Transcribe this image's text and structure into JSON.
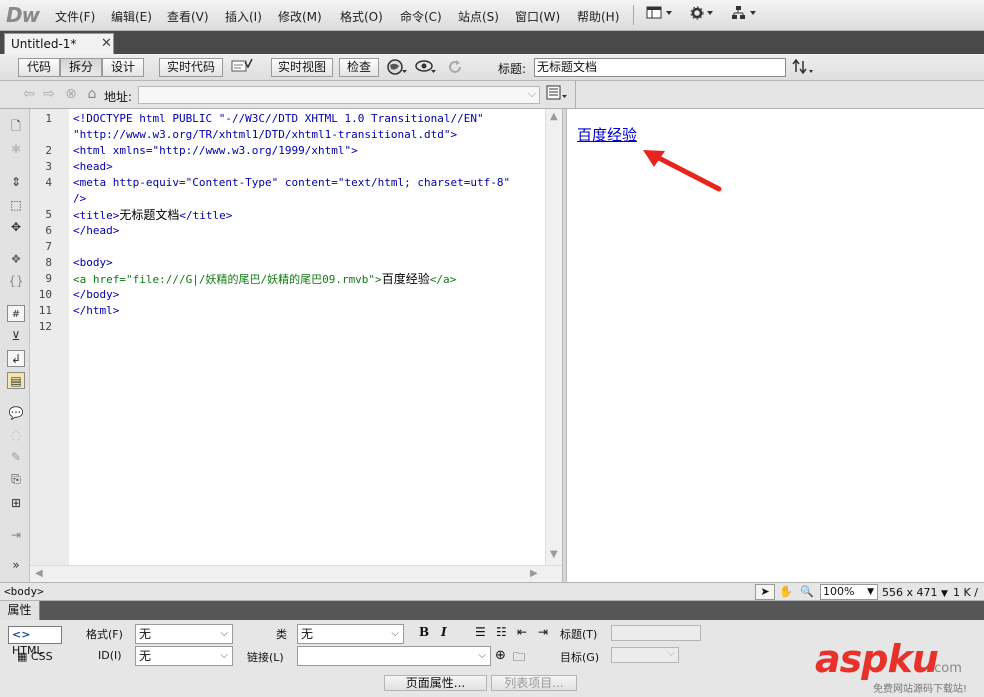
{
  "app": {
    "logo": "Dw"
  },
  "menu": {
    "items": [
      "文件(F)",
      "编辑(E)",
      "查看(V)",
      "插入(I)",
      "修改(M)",
      "格式(O)",
      "命令(C)",
      "站点(S)",
      "窗口(W)",
      "帮助(H)"
    ]
  },
  "tab": {
    "title": "Untitled-1*"
  },
  "doc_toolbar": {
    "code": "代码",
    "split": "拆分",
    "design": "设计",
    "live_code": "实时代码",
    "live_view": "实时视图",
    "inspect": "检查",
    "title_label": "标题:",
    "title_value": "无标题文档"
  },
  "address": {
    "label": "地址:",
    "value": ""
  },
  "code": {
    "lines": [
      {
        "num": "1",
        "text": "<!DOCTYPE html PUBLIC \"-//W3C//DTD XHTML 1.0 Transitional//EN\""
      },
      {
        "num": "",
        "text": "\"http://www.w3.org/TR/xhtml1/DTD/xhtml1-transitional.dtd\">"
      },
      {
        "num": "2",
        "text": "<html xmlns=\"http://www.w3.org/1999/xhtml\">"
      },
      {
        "num": "3",
        "text": "<head>"
      },
      {
        "num": "4",
        "text": "<meta http-equiv=\"Content-Type\" content=\"text/html; charset=utf-8\""
      },
      {
        "num": "",
        "text": "/>"
      },
      {
        "num": "5",
        "text_pre": "<title>",
        "text_mid": "无标题文档",
        "text_post": "</title>"
      },
      {
        "num": "6",
        "text": "</head>"
      },
      {
        "num": "7",
        "text": ""
      },
      {
        "num": "8",
        "text": "<body>"
      },
      {
        "num": "9",
        "text_pre": "<a href=\"file:///G|/妖精的尾巴/妖精的尾巴09.rmvb\">",
        "text_mid": "百度经验",
        "text_post": "</a>"
      },
      {
        "num": "10",
        "text": "</body>"
      },
      {
        "num": "11",
        "text": "</html>"
      },
      {
        "num": "12",
        "text": ""
      }
    ]
  },
  "design_view": {
    "link_text": "百度经验"
  },
  "status": {
    "tag": "<body>",
    "zoom": "100%",
    "window_size": "556 x 471",
    "file_size": "1 K /"
  },
  "properties": {
    "title": "属性",
    "html_label": "HTML",
    "css_label": "CSS",
    "format_label": "格式(F)",
    "format_value": "无",
    "id_label": "ID(I)",
    "id_value": "无",
    "class_label": "类",
    "class_value": "无",
    "link_label": "链接(L)",
    "link_value": "",
    "bold": "B",
    "italic": "I",
    "title_label": "标题(T)",
    "target_label": "目标(G)",
    "page_props": "页面属性...",
    "list_item": "列表项目..."
  },
  "watermark": {
    "text": "aspku",
    "suffix": ".com",
    "sub": "免费网站源码下载站!"
  },
  "colors": {
    "link": "#0000cc",
    "code_tag": "#0000a8",
    "annotation_arrow": "#e8241f",
    "watermark": "#e8312a"
  }
}
